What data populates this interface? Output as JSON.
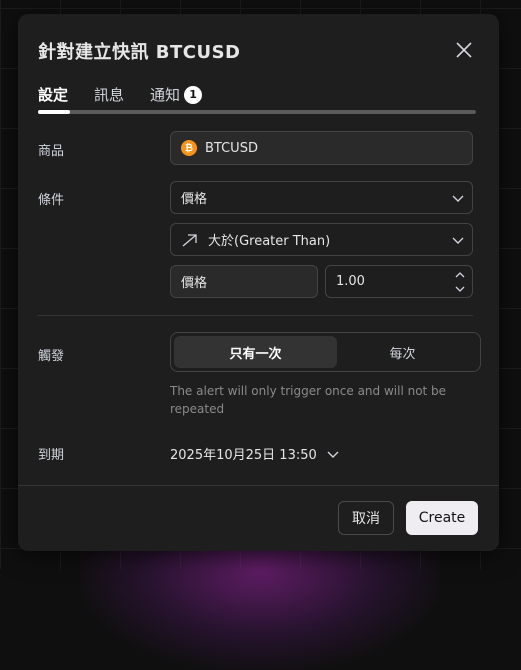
{
  "dialog": {
    "title": "針對建立快訊 BTCUSD",
    "tabs": [
      {
        "label": "設定"
      },
      {
        "label": "訊息"
      },
      {
        "label": "通知",
        "count": "1"
      }
    ],
    "symbol": {
      "label": "商品",
      "value": "BTCUSD",
      "icon": "bitcoin-icon"
    },
    "condition": {
      "label": "條件",
      "source": "價格",
      "operator": "大於(Greater Than)",
      "target_type": "價格",
      "target_value": "1.00"
    },
    "trigger": {
      "label": "觸發",
      "options": [
        "只有一次",
        "每次"
      ],
      "selected": "只有一次",
      "hint": "The alert will only trigger once and will not be repeated"
    },
    "expiry": {
      "label": "到期",
      "value": "2025年10月25日 13:50"
    },
    "buttons": {
      "cancel": "取消",
      "create": "Create"
    }
  },
  "colors": {
    "dialog_bg": "#1e1e1e",
    "accent_btc": "#f7931a",
    "create_bg": "#f0edf2"
  }
}
